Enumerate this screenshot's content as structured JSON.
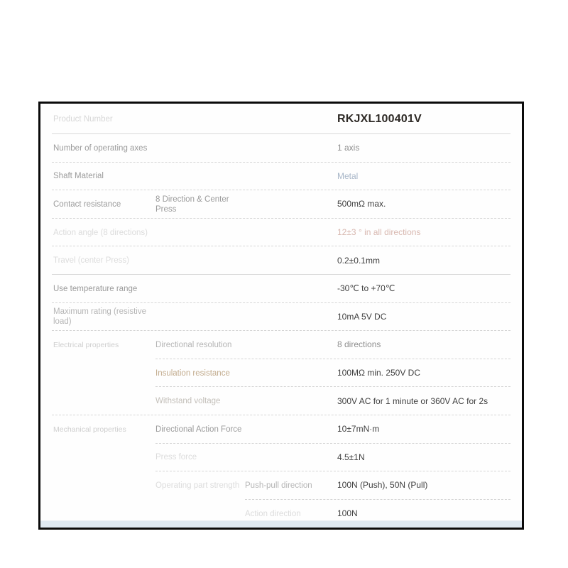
{
  "card": {
    "border_color": "#0b0b0b",
    "background": "#ffffff"
  },
  "table": {
    "columns": [
      "Category",
      "Sub item",
      "Detail item",
      "Value"
    ],
    "rows": [
      {
        "label": "Product Number",
        "sub": "",
        "sub2": "",
        "value": "RKJXL100401V",
        "label_tone": "faint",
        "value_tone": "header",
        "separator": "solid"
      },
      {
        "label": "Number of operating axes",
        "sub": "",
        "sub2": "",
        "value": "1 axis",
        "label_tone": "strong",
        "value_tone": "mid",
        "separator": "dash"
      },
      {
        "label": "Shaft Material",
        "sub": "",
        "sub2": "",
        "value": "Metal",
        "label_tone": "strong",
        "value_tone": "blue",
        "separator": "dash"
      },
      {
        "label": "Contact resistance",
        "sub": "8 Direction & Center Press",
        "sub2": "",
        "value": "500mΩ max.",
        "label_tone": "strong",
        "sub_tone": "strong",
        "value_tone": "strong",
        "separator": "dash"
      },
      {
        "label": "Action angle (8 directions)",
        "sub": "",
        "sub2": "",
        "value": "12±3 ° in all directions",
        "label_tone": "faint",
        "value_tone": "pink",
        "separator": "dash"
      },
      {
        "label": "Travel (center Press)",
        "sub": "",
        "sub2": "",
        "value": "0.2±0.1mm",
        "label_tone": "faint",
        "value_tone": "strong",
        "separator": "solid"
      },
      {
        "label": "Use temperature range",
        "sub": "",
        "sub2": "",
        "value": "-30℃ to +70℃",
        "label_tone": "strong",
        "value_tone": "strong",
        "separator": "dash"
      },
      {
        "label": "Maximum rating (resistive load)",
        "sub": "",
        "sub2": "",
        "value": "10mA 5V DC",
        "label_tone": "mid",
        "value_tone": "strong",
        "separator": "dash"
      },
      {
        "label": "Electrical properties",
        "sub": "Directional resolution",
        "sub2": "",
        "value": "8 directions",
        "label_tone": "group",
        "sub_tone": "mid",
        "value_tone": "mid",
        "separator": "dash-indent1"
      },
      {
        "label": "",
        "sub": "Insulation resistance",
        "sub2": "",
        "value": "100MΩ min. 250V DC",
        "sub_tone": "brown",
        "value_tone": "strong",
        "separator": "dash-indent1"
      },
      {
        "label": "",
        "sub": "Withstand voltage",
        "sub2": "",
        "value": "300V AC for 1 minute or 360V AC for 2s",
        "sub_tone": "warmgray",
        "value_tone": "strong",
        "separator": "dash"
      },
      {
        "label": "Mechanical properties",
        "sub": "Directional Action Force",
        "sub2": "",
        "value": "10±7mN·m",
        "label_tone": "group",
        "sub_tone": "strong",
        "value_tone": "strong",
        "separator": "dash-indent1"
      },
      {
        "label": "",
        "sub": "Press force",
        "sub2": "",
        "value": "4.5±1N",
        "sub_tone": "faint",
        "value_tone": "strong",
        "separator": "dash-indent1"
      },
      {
        "label": "",
        "sub": "Operating part strength",
        "sub2": "Push-pull direction",
        "value": "100N (Push), 50N (Pull)",
        "sub_tone": "faint",
        "sub2_tone": "mid",
        "value_tone": "strong",
        "separator": "dash-indent2"
      },
      {
        "label": "",
        "sub": "",
        "sub2": "Action direction",
        "value": "100N",
        "sub2_tone": "faint",
        "value_tone": "strong",
        "separator": "dash"
      }
    ]
  },
  "colors": {
    "label_default": "#bdbdbd",
    "value_default": "#4b4b4b",
    "accent_blue": "#a8b6c8",
    "accent_pink": "#d8b8b0",
    "accent_brown": "#c2ab8d",
    "separator_solid": "#d9d9d9",
    "separator_dash": "#d5d5d5",
    "band": "#dfe9f2"
  }
}
